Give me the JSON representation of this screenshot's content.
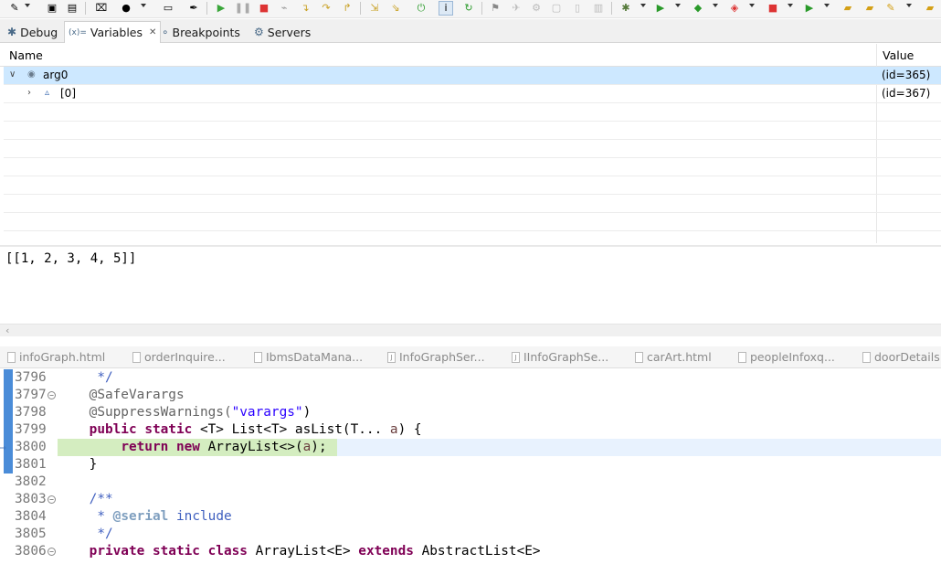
{
  "toolbar": {
    "icons": [
      "new-icon",
      "save-icon",
      "save-all-icon",
      "binary-icon",
      "user-icon",
      "terminal-icon",
      "pin-icon",
      "resume-icon",
      "suspend-icon",
      "terminate-icon",
      "disconnect-icon",
      "step-into-icon",
      "step-over-icon",
      "step-return-icon",
      "drop-frame-icon",
      "use-step-filters-icon",
      "power-icon",
      "instruction-step-icon",
      "refresh-icon",
      "bookmark-icon",
      "run-last-icon",
      "debug-icon",
      "run-icon",
      "coverage-icon",
      "server-icon",
      "external-tools-icon",
      "open-folder-icon",
      "edit-icon",
      "search-icon"
    ]
  },
  "views": {
    "tabs": [
      {
        "label": "Debug",
        "icon": "bug-icon"
      },
      {
        "label": "Variables",
        "icon": "variables-icon",
        "prefix": "(x)="
      },
      {
        "label": "Breakpoints",
        "icon": "breakpoint-icon"
      },
      {
        "label": "Servers",
        "icon": "servers-icon"
      }
    ],
    "active": "Variables"
  },
  "variables": {
    "columns": {
      "name": "Name",
      "value": "Value"
    },
    "rows": [
      {
        "name": "arg0",
        "value": "(id=365)",
        "expanded": true,
        "selected": true
      },
      {
        "name": "[0]",
        "value": "(id=367)",
        "expanded": false,
        "selected": false
      }
    ],
    "detail": "[[1, 2, 3, 4, 5]]"
  },
  "editor_tabs": [
    "infoGraph.html",
    "orderInquire...",
    "IbmsDataMana...",
    "InfoGraphSer...",
    "IInfoGraphSe...",
    "carArt.html",
    "peopleInfoxq...",
    "doorDetails..."
  ],
  "editor": {
    "current_line": "3800",
    "lines": [
      {
        "num": "3796"
      },
      {
        "num": "3797"
      },
      {
        "num": "3798"
      },
      {
        "num": "3799"
      },
      {
        "num": "3800"
      },
      {
        "num": "3801"
      },
      {
        "num": "3802"
      },
      {
        "num": "3803"
      },
      {
        "num": "3804"
      },
      {
        "num": "3805"
      },
      {
        "num": "3806"
      }
    ],
    "tokens": {
      "c3796": "*/",
      "c3797": "@SafeVarargs",
      "c3798_a": "@SuppressWarnings(",
      "c3798_s": "\"varargs\"",
      "c3798_b": ")",
      "c3799_k1": "public",
      "c3799_k2": "static",
      "c3799_rest1": "<T> List<T> asList(T... ",
      "c3799_var": "a",
      "c3799_rest2": ") {",
      "c3800_k1": "return",
      "c3800_k2": "new",
      "c3800_rest1": "ArrayList<>(",
      "c3800_var": "a",
      "c3800_rest2": ");",
      "c3801": "}",
      "c3803": "/**",
      "c3804_star": "*",
      "c3804_tag": "@serial",
      "c3804_txt": "include",
      "c3805": "*/",
      "c3806_k1": "private",
      "c3806_k2": "static",
      "c3806_k3": "class",
      "c3806_rest1": "ArrayList<E>",
      "c3806_k4": "extends",
      "c3806_rest2": "AbstractList<E>"
    }
  },
  "colors": {
    "keyword": "#7f0055",
    "string": "#2a00ff",
    "javadoc": "#3f5fbf",
    "selection": "#cde8ff",
    "current_line": "#d4edc0"
  }
}
